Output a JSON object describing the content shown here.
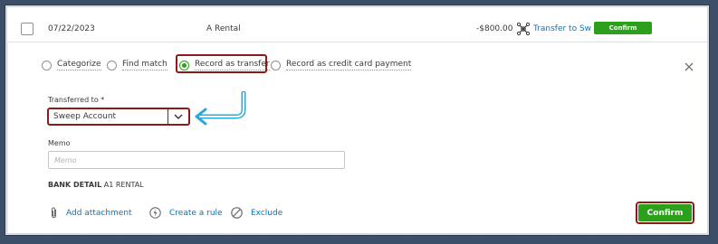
{
  "transaction": {
    "date": "07/22/2023",
    "description": "A Rental",
    "amount": "-$800.00",
    "category_icon": "transfer-icon",
    "category": "Transfer to Swe",
    "confirm_label": "Confirm"
  },
  "action_options": [
    {
      "label": "Categorize",
      "selected": false
    },
    {
      "label": "Find match",
      "selected": false
    },
    {
      "label": "Record as transfer",
      "selected": true
    },
    {
      "label": "Record as credit card payment",
      "selected": false
    }
  ],
  "transferred_to": {
    "label": "Transferred to *",
    "value": "Sweep Account"
  },
  "memo": {
    "label": "Memo",
    "placeholder": "Memo",
    "value": ""
  },
  "bank_detail": {
    "label": "BANK DETAIL",
    "value": "A1 RENTAL"
  },
  "footer": {
    "add_attachment": "Add attachment",
    "create_rule": "Create a rule",
    "exclude": "Exclude",
    "confirm_label": "Confirm"
  },
  "colors": {
    "background": "#3d4f68",
    "accent_green": "#2ca01c",
    "link_blue": "#0077c5",
    "highlight_red": "#8b1a1a",
    "arrow_blue": "#2aa8d8"
  }
}
